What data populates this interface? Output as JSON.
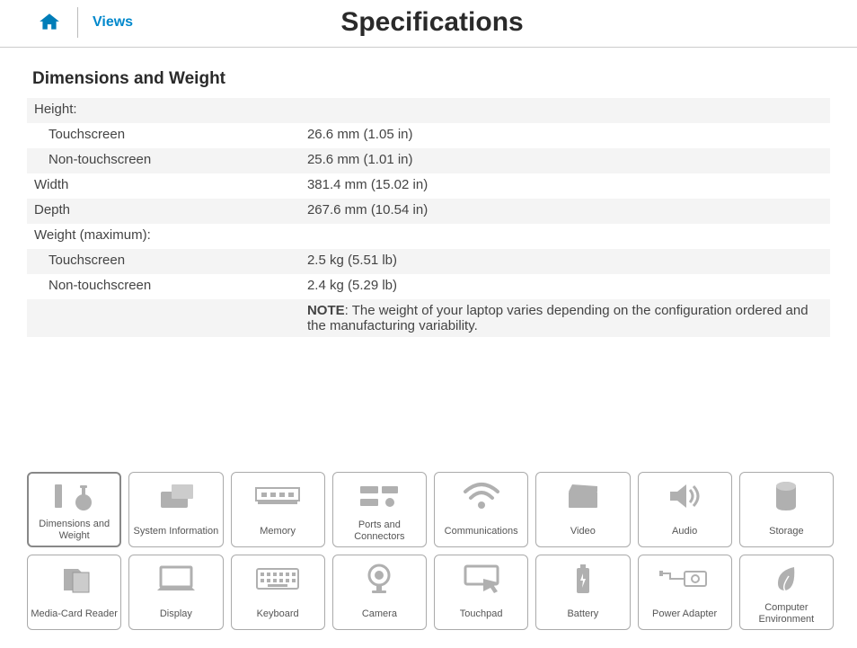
{
  "header": {
    "views_label": "Views",
    "title": "Specifications"
  },
  "section": {
    "title": "Dimensions and Weight"
  },
  "rows": {
    "r0": "Height:",
    "r1_label": "Touchscreen",
    "r1_value": "26.6 mm (1.05 in)",
    "r2_label": "Non-touchscreen",
    "r2_value": "25.6 mm (1.01 in)",
    "r3_label": "Width",
    "r3_value": "381.4 mm (15.02 in)",
    "r4_label": "Depth",
    "r4_value": "267.6 mm (10.54 in)",
    "r5": "Weight (maximum):",
    "r6_label": "Touchscreen",
    "r6_value": "2.5 kg (5.51 lb)",
    "r7_label": "Non-touchscreen",
    "r7_value": "2.4 kg (5.29 lb)",
    "note_prefix": "NOTE",
    "note_text": ": The weight of your laptop varies depending on the configuration ordered and the manufacturing variability."
  },
  "tiles": {
    "t0": "Dimensions and Weight",
    "t1": "System Information",
    "t2": "Memory",
    "t3": "Ports and Connectors",
    "t4": "Communications",
    "t5": "Video",
    "t6": "Audio",
    "t7": "Storage",
    "t8": "Media-Card Reader",
    "t9": "Display",
    "t10": "Keyboard",
    "t11": "Camera",
    "t12": "Touchpad",
    "t13": "Battery",
    "t14": "Power Adapter",
    "t15": "Computer Environment"
  }
}
